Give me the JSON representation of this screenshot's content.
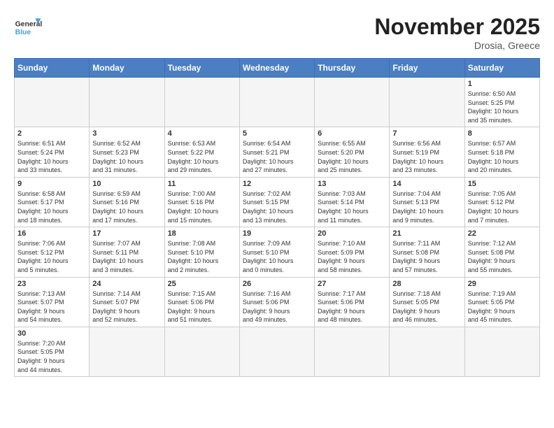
{
  "header": {
    "logo_general": "General",
    "logo_blue": "Blue",
    "month_title": "November 2025",
    "location": "Drosia, Greece"
  },
  "weekdays": [
    "Sunday",
    "Monday",
    "Tuesday",
    "Wednesday",
    "Thursday",
    "Friday",
    "Saturday"
  ],
  "days": [
    {
      "num": "",
      "info": ""
    },
    {
      "num": "",
      "info": ""
    },
    {
      "num": "",
      "info": ""
    },
    {
      "num": "",
      "info": ""
    },
    {
      "num": "",
      "info": ""
    },
    {
      "num": "",
      "info": ""
    },
    {
      "num": "1",
      "info": "Sunrise: 6:50 AM\nSunset: 5:25 PM\nDaylight: 10 hours\nand 35 minutes."
    },
    {
      "num": "2",
      "info": "Sunrise: 6:51 AM\nSunset: 5:24 PM\nDaylight: 10 hours\nand 33 minutes."
    },
    {
      "num": "3",
      "info": "Sunrise: 6:52 AM\nSunset: 5:23 PM\nDaylight: 10 hours\nand 31 minutes."
    },
    {
      "num": "4",
      "info": "Sunrise: 6:53 AM\nSunset: 5:22 PM\nDaylight: 10 hours\nand 29 minutes."
    },
    {
      "num": "5",
      "info": "Sunrise: 6:54 AM\nSunset: 5:21 PM\nDaylight: 10 hours\nand 27 minutes."
    },
    {
      "num": "6",
      "info": "Sunrise: 6:55 AM\nSunset: 5:20 PM\nDaylight: 10 hours\nand 25 minutes."
    },
    {
      "num": "7",
      "info": "Sunrise: 6:56 AM\nSunset: 5:19 PM\nDaylight: 10 hours\nand 23 minutes."
    },
    {
      "num": "8",
      "info": "Sunrise: 6:57 AM\nSunset: 5:18 PM\nDaylight: 10 hours\nand 20 minutes."
    },
    {
      "num": "9",
      "info": "Sunrise: 6:58 AM\nSunset: 5:17 PM\nDaylight: 10 hours\nand 18 minutes."
    },
    {
      "num": "10",
      "info": "Sunrise: 6:59 AM\nSunset: 5:16 PM\nDaylight: 10 hours\nand 17 minutes."
    },
    {
      "num": "11",
      "info": "Sunrise: 7:00 AM\nSunset: 5:16 PM\nDaylight: 10 hours\nand 15 minutes."
    },
    {
      "num": "12",
      "info": "Sunrise: 7:02 AM\nSunset: 5:15 PM\nDaylight: 10 hours\nand 13 minutes."
    },
    {
      "num": "13",
      "info": "Sunrise: 7:03 AM\nSunset: 5:14 PM\nDaylight: 10 hours\nand 11 minutes."
    },
    {
      "num": "14",
      "info": "Sunrise: 7:04 AM\nSunset: 5:13 PM\nDaylight: 10 hours\nand 9 minutes."
    },
    {
      "num": "15",
      "info": "Sunrise: 7:05 AM\nSunset: 5:12 PM\nDaylight: 10 hours\nand 7 minutes."
    },
    {
      "num": "16",
      "info": "Sunrise: 7:06 AM\nSunset: 5:12 PM\nDaylight: 10 hours\nand 5 minutes."
    },
    {
      "num": "17",
      "info": "Sunrise: 7:07 AM\nSunset: 5:11 PM\nDaylight: 10 hours\nand 3 minutes."
    },
    {
      "num": "18",
      "info": "Sunrise: 7:08 AM\nSunset: 5:10 PM\nDaylight: 10 hours\nand 2 minutes."
    },
    {
      "num": "19",
      "info": "Sunrise: 7:09 AM\nSunset: 5:10 PM\nDaylight: 10 hours\nand 0 minutes."
    },
    {
      "num": "20",
      "info": "Sunrise: 7:10 AM\nSunset: 5:09 PM\nDaylight: 9 hours\nand 58 minutes."
    },
    {
      "num": "21",
      "info": "Sunrise: 7:11 AM\nSunset: 5:08 PM\nDaylight: 9 hours\nand 57 minutes."
    },
    {
      "num": "22",
      "info": "Sunrise: 7:12 AM\nSunset: 5:08 PM\nDaylight: 9 hours\nand 55 minutes."
    },
    {
      "num": "23",
      "info": "Sunrise: 7:13 AM\nSunset: 5:07 PM\nDaylight: 9 hours\nand 54 minutes."
    },
    {
      "num": "24",
      "info": "Sunrise: 7:14 AM\nSunset: 5:07 PM\nDaylight: 9 hours\nand 52 minutes."
    },
    {
      "num": "25",
      "info": "Sunrise: 7:15 AM\nSunset: 5:06 PM\nDaylight: 9 hours\nand 51 minutes."
    },
    {
      "num": "26",
      "info": "Sunrise: 7:16 AM\nSunset: 5:06 PM\nDaylight: 9 hours\nand 49 minutes."
    },
    {
      "num": "27",
      "info": "Sunrise: 7:17 AM\nSunset: 5:06 PM\nDaylight: 9 hours\nand 48 minutes."
    },
    {
      "num": "28",
      "info": "Sunrise: 7:18 AM\nSunset: 5:05 PM\nDaylight: 9 hours\nand 46 minutes."
    },
    {
      "num": "29",
      "info": "Sunrise: 7:19 AM\nSunset: 5:05 PM\nDaylight: 9 hours\nand 45 minutes."
    },
    {
      "num": "30",
      "info": "Sunrise: 7:20 AM\nSunset: 5:05 PM\nDaylight: 9 hours\nand 44 minutes."
    }
  ]
}
